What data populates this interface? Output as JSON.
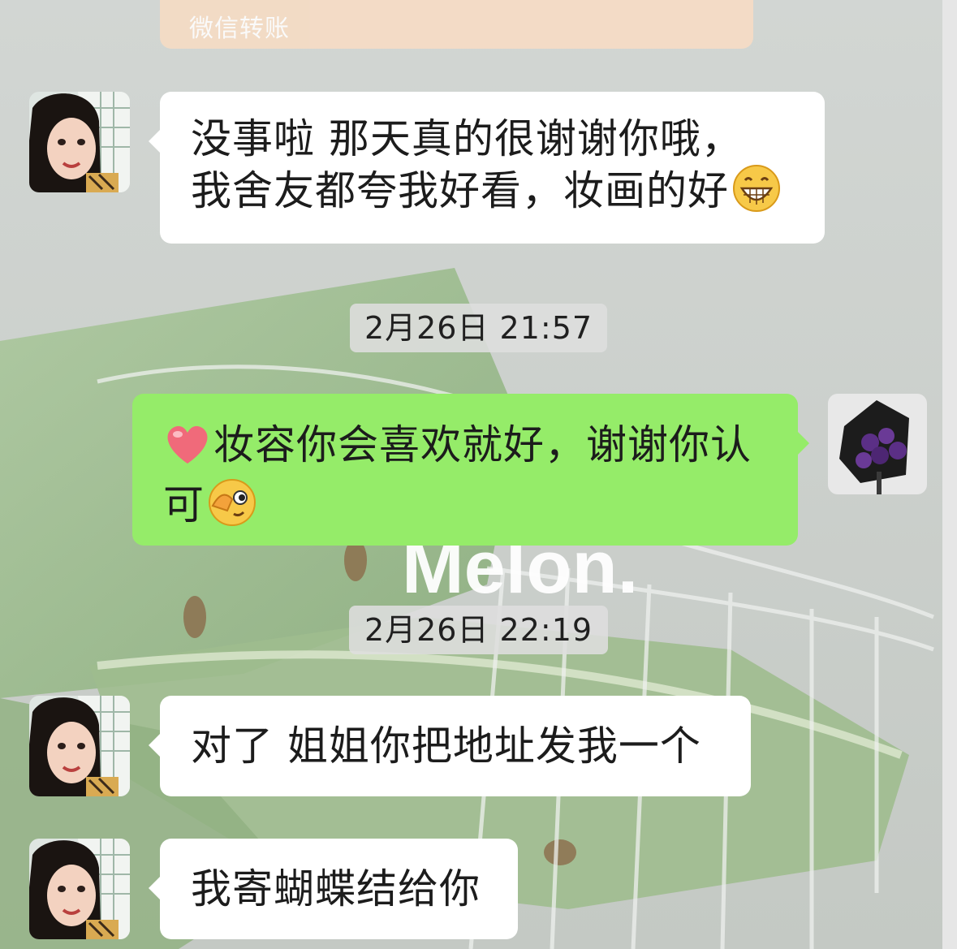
{
  "transfer": {
    "label": "微信转账"
  },
  "wallpaper": {
    "text": "Melon."
  },
  "messages": [
    {
      "side": "in",
      "lines": [
        "没事啦  那天真的很谢谢你哦，",
        "我舍友都夸我好看，妆画的好"
      ],
      "trailing_emoji": "grinning-face"
    },
    {
      "side": "out",
      "lines": [
        "妆容你会喜欢就好，谢谢你认",
        "可"
      ],
      "leading_emoji": "heart",
      "trailing_emoji": "winking-face"
    },
    {
      "side": "in",
      "lines": [
        "对了  姐姐你把地址发我一个"
      ]
    },
    {
      "side": "in",
      "lines": [
        "我寄蝴蝶结给你"
      ]
    }
  ],
  "timestamps": [
    "2月26日 21:57",
    "2月26日 22:19"
  ],
  "colors": {
    "outgoing_bubble": "#95ec69",
    "incoming_bubble": "#ffffff",
    "transfer_card": "#f6dcc4"
  }
}
